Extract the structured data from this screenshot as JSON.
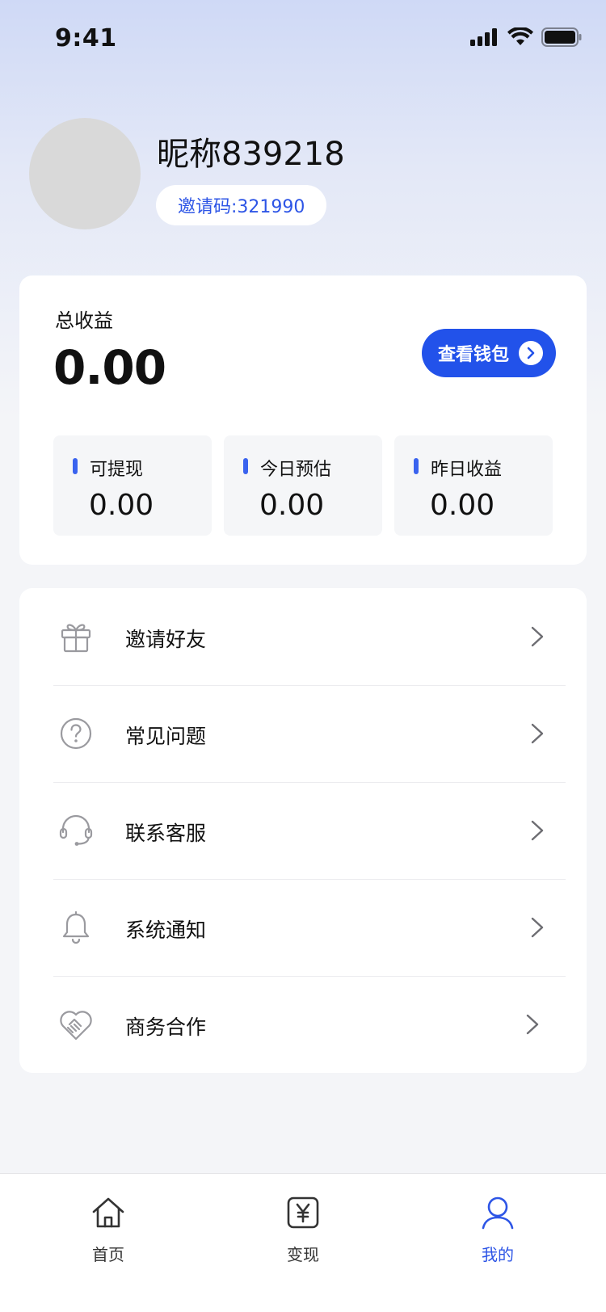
{
  "status_bar": {
    "time": "9:41"
  },
  "profile": {
    "nickname": "昵称839218",
    "invite_code": "邀请码:321990"
  },
  "earnings": {
    "title": "总收益",
    "total": "0.00",
    "wallet_button": "查看钱包",
    "stats": [
      {
        "label": "可提现",
        "value": "0.00"
      },
      {
        "label": "今日预估",
        "value": "0.00"
      },
      {
        "label": "昨日收益",
        "value": "0.00"
      }
    ]
  },
  "menu": {
    "items": [
      {
        "label": "邀请好友",
        "icon": "gift-icon"
      },
      {
        "label": "常见问题",
        "icon": "question-icon"
      },
      {
        "label": "联系客服",
        "icon": "headset-icon"
      },
      {
        "label": "系统通知",
        "icon": "bell-icon"
      },
      {
        "label": "商务合作",
        "icon": "handshake-icon"
      }
    ]
  },
  "tabbar": {
    "tabs": [
      {
        "label": "首页",
        "icon": "home-icon"
      },
      {
        "label": "变现",
        "icon": "yuan-icon"
      },
      {
        "label": "我的",
        "icon": "user-icon",
        "active": true
      }
    ]
  },
  "colors": {
    "accent": "#2252ea",
    "accent_text": "#2d55e6",
    "icon_gray": "#9a9a9f"
  }
}
